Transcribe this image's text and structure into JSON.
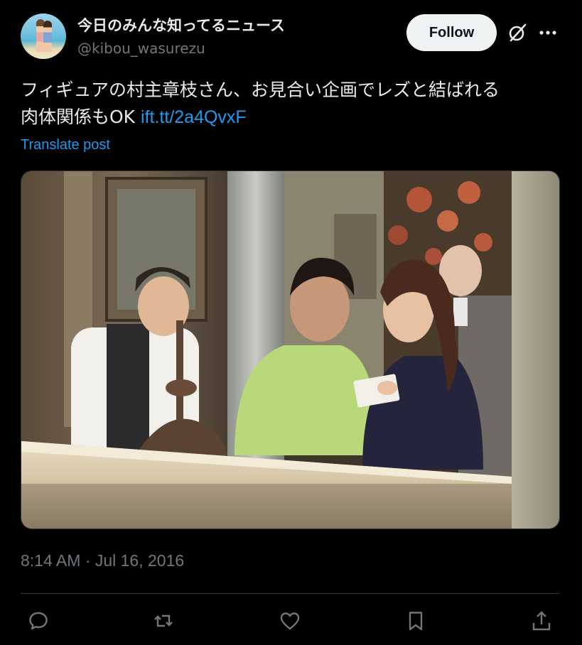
{
  "author": {
    "display_name": "今日のみんな知ってるニュース",
    "handle": "@kibou_wasurezu",
    "avatar_icon": "profile-photo"
  },
  "header": {
    "follow_label": "Follow",
    "grok_icon": "grok-icon",
    "more_icon": "more-icon"
  },
  "tweet": {
    "text_line1": "フィギュアの村主章枝さん、お見合い企画でレズと結ばれる",
    "text_line2": "肉体関係もOK",
    "link": "ift.tt/2a4QvxF",
    "translate_label": "Translate post",
    "timestamp": "8:14 AM · Jul 16, 2016"
  },
  "actions": [
    {
      "name": "reply",
      "icon": "reply-icon"
    },
    {
      "name": "repost",
      "icon": "repost-icon"
    },
    {
      "name": "like",
      "icon": "heart-icon"
    },
    {
      "name": "bookmark",
      "icon": "bookmark-icon"
    },
    {
      "name": "share",
      "icon": "share-icon"
    }
  ],
  "colors": {
    "background": "#000000",
    "text": "#e7e9ea",
    "secondary": "#71767b",
    "link": "#1d9bf0",
    "follow_bg": "#eff3f4"
  }
}
